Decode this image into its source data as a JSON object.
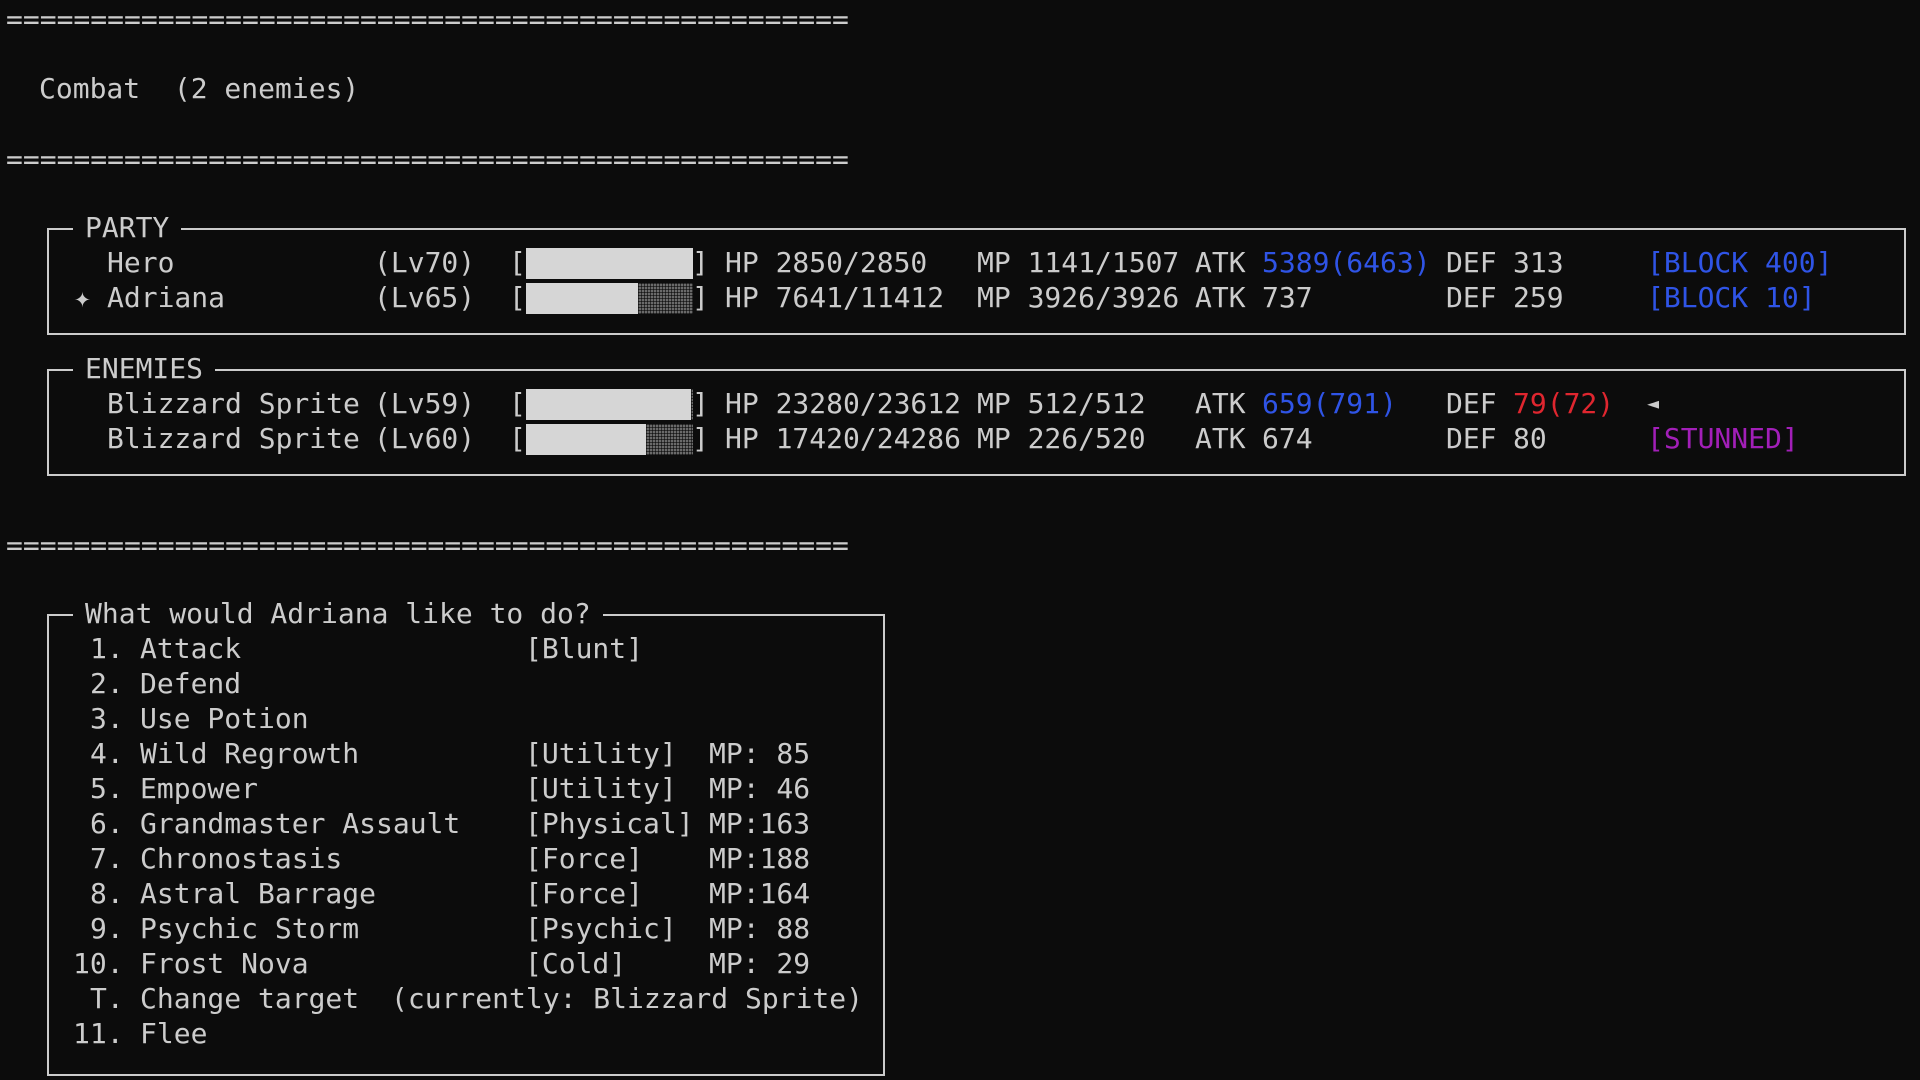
{
  "separator": "==================================================",
  "header": {
    "title": "Combat  (2 enemies)"
  },
  "party": {
    "title": "PARTY",
    "members": [
      {
        "marker": "",
        "name": "Hero",
        "level": "(Lv70)",
        "hp_fraction": 1.0,
        "hp": "HP 2850/2850",
        "mp": "MP 1141/1507",
        "atk_label": "ATK",
        "atk": "5389(6463)",
        "def_label": "DEF",
        "def": "313",
        "status": "[BLOCK 400]"
      },
      {
        "marker": "✦",
        "name": "Adriana",
        "level": "(Lv65)",
        "hp_fraction": 0.67,
        "hp": "HP 7641/11412",
        "mp": "MP 3926/3926",
        "atk_label": "ATK",
        "atk": "737",
        "def_label": "DEF",
        "def": "259",
        "status": "[BLOCK 10]"
      }
    ]
  },
  "enemies": {
    "title": "ENEMIES",
    "members": [
      {
        "name": "Blizzard Sprite",
        "level": "(Lv59)",
        "hp_fraction": 0.986,
        "hp": "HP 23280/23612",
        "mp": "MP 512/512",
        "atk_label": "ATK",
        "atk": "659(791)",
        "def_label": "DEF",
        "def": "79(72)",
        "status": "◄"
      },
      {
        "name": "Blizzard Sprite",
        "level": "(Lv60)",
        "hp_fraction": 0.717,
        "hp": "HP 17420/24286",
        "mp": "MP 226/520",
        "atk_label": "ATK",
        "atk": "674",
        "def_label": "DEF",
        "def": "80",
        "status": "[STUNNED]"
      }
    ]
  },
  "menu": {
    "title": "What would Adriana like to do?",
    "items": [
      {
        "key": "1.",
        "label": "Attack",
        "tag": "[Blunt]",
        "cost": ""
      },
      {
        "key": "2.",
        "label": "Defend",
        "tag": "",
        "cost": ""
      },
      {
        "key": "3.",
        "label": "Use Potion",
        "tag": "",
        "cost": ""
      },
      {
        "key": "4.",
        "label": "Wild Regrowth",
        "tag": "[Utility]",
        "cost": "MP: 85"
      },
      {
        "key": "5.",
        "label": "Empower",
        "tag": "[Utility]",
        "cost": "MP: 46"
      },
      {
        "key": "6.",
        "label": "Grandmaster Assault",
        "tag": "[Physical]",
        "cost": "MP:163"
      },
      {
        "key": "7.",
        "label": "Chronostasis",
        "tag": "[Force]",
        "cost": "MP:188"
      },
      {
        "key": "8.",
        "label": "Astral Barrage",
        "tag": "[Force]",
        "cost": "MP:164"
      },
      {
        "key": "9.",
        "label": "Psychic Storm",
        "tag": "[Psychic]",
        "cost": "MP: 88"
      },
      {
        "key": "10.",
        "label": "Frost Nova",
        "tag": "[Cold]",
        "cost": "MP: 29"
      }
    ],
    "change_target": {
      "key": "T.",
      "label": "Change target",
      "detail": "(currently: Blizzard Sprite)"
    },
    "flee": {
      "key": "11.",
      "label": "Flee"
    }
  },
  "colors": {
    "background": "#0c0c0c",
    "text": "#cccccc",
    "buff": "#2f54e6",
    "debuff": "#e0262f",
    "stunned": "#a21fb8"
  }
}
